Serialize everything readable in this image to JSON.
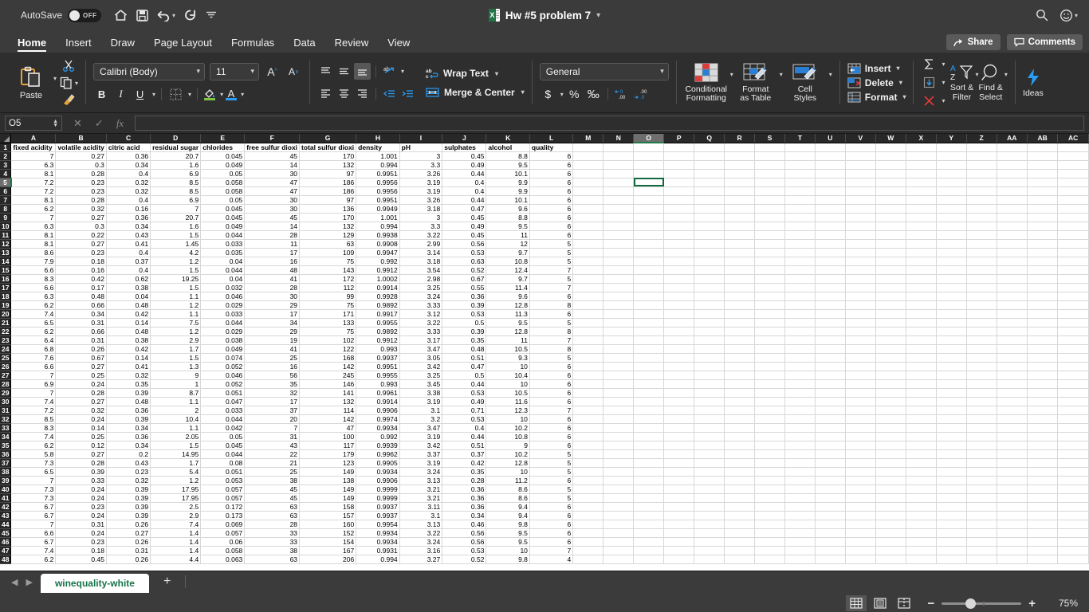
{
  "titlebar": {
    "autosave_label": "AutoSave",
    "autosave_state": "OFF",
    "document_title": "Hw #5 problem 7",
    "quick_access": [
      "home-icon",
      "save-icon",
      "undo-icon",
      "redo-icon",
      "customize-icon"
    ],
    "right_icons": [
      "search-icon",
      "account-icon"
    ]
  },
  "tabs": [
    {
      "label": "Home",
      "active": true
    },
    {
      "label": "Insert",
      "active": false
    },
    {
      "label": "Draw",
      "active": false
    },
    {
      "label": "Page Layout",
      "active": false
    },
    {
      "label": "Formulas",
      "active": false
    },
    {
      "label": "Data",
      "active": false
    },
    {
      "label": "Review",
      "active": false
    },
    {
      "label": "View",
      "active": false
    }
  ],
  "tabbar_right": {
    "share_label": "Share",
    "comments_label": "Comments"
  },
  "ribbon": {
    "clipboard": {
      "paste_label": "Paste",
      "cut_icon": "scissors-icon",
      "copy_icon": "copy-icon",
      "format_painter_icon": "format-painter-icon"
    },
    "font": {
      "font_name": "Calibri (Body)",
      "font_size": "11",
      "grow_font": "A",
      "shrink_font": "A",
      "bold": "B",
      "italic": "I",
      "underline": "U",
      "fill_color": "#7dc242",
      "font_color": "#2a9df4"
    },
    "alignment": {
      "wrap_text_label": "Wrap Text",
      "merge_center_label": "Merge & Center",
      "orientation_icon": "orientation-icon"
    },
    "number": {
      "format": "General",
      "currency": "$",
      "percent": "%",
      "comma": "‰",
      "increase_decimal": "increase-decimal-icon",
      "decrease_decimal": "decrease-decimal-icon"
    },
    "styles": [
      {
        "label": "Conditional\nFormatting",
        "line1": "Conditional",
        "line2": "Formatting"
      },
      {
        "label": "Format as Table",
        "line1": "Format",
        "line2": "as Table"
      },
      {
        "label": "Cell Styles",
        "line1": "Cell",
        "line2": "Styles"
      }
    ],
    "cells": {
      "insert_label": "Insert",
      "delete_label": "Delete",
      "format_label": "Format"
    },
    "editing": {
      "autosum_icon": "sigma-icon",
      "fill_icon": "fill-down-icon",
      "clear_icon": "clear-icon",
      "sort_filter_line1": "Sort &",
      "sort_filter_line2": "Filter",
      "find_select_line1": "Find &",
      "find_select_line2": "Select"
    },
    "ideas": {
      "label": "Ideas"
    }
  },
  "formula_bar": {
    "name_box": "O5",
    "formula_value": "",
    "cancel_icon": "x-icon",
    "confirm_icon": "check-icon",
    "function_icon": "fx-icon"
  },
  "sheet": {
    "selected_cell": "O5",
    "selected_col_index": 15,
    "selected_row_index": 5,
    "columns": [
      "A",
      "B",
      "C",
      "D",
      "E",
      "F",
      "G",
      "H",
      "I",
      "J",
      "K",
      "L",
      "M",
      "N",
      "O",
      "P",
      "Q",
      "R",
      "S",
      "T",
      "U",
      "V",
      "W",
      "X",
      "Y",
      "Z",
      "AA",
      "AB",
      "AC"
    ],
    "headers": [
      "fixed acidity",
      "volatile acidity",
      "citric acid",
      "residual sugar",
      "chlorides",
      "free sulfur dioxi",
      "total sulfur dioxi",
      "density",
      "pH",
      "sulphates",
      "alcohol",
      "quality"
    ],
    "rows": [
      [
        7,
        0.27,
        0.36,
        20.7,
        0.045,
        45,
        170,
        1.001,
        3,
        0.45,
        8.8,
        6
      ],
      [
        6.3,
        0.3,
        0.34,
        1.6,
        0.049,
        14,
        132,
        0.994,
        3.3,
        0.49,
        9.5,
        6
      ],
      [
        8.1,
        0.28,
        0.4,
        6.9,
        0.05,
        30,
        97,
        0.9951,
        3.26,
        0.44,
        10.1,
        6
      ],
      [
        7.2,
        0.23,
        0.32,
        8.5,
        0.058,
        47,
        186,
        0.9956,
        3.19,
        0.4,
        9.9,
        6
      ],
      [
        7.2,
        0.23,
        0.32,
        8.5,
        0.058,
        47,
        186,
        0.9956,
        3.19,
        0.4,
        9.9,
        6
      ],
      [
        8.1,
        0.28,
        0.4,
        6.9,
        0.05,
        30,
        97,
        0.9951,
        3.26,
        0.44,
        10.1,
        6
      ],
      [
        6.2,
        0.32,
        0.16,
        7,
        0.045,
        30,
        136,
        0.9949,
        3.18,
        0.47,
        9.6,
        6
      ],
      [
        7,
        0.27,
        0.36,
        20.7,
        0.045,
        45,
        170,
        1.001,
        3,
        0.45,
        8.8,
        6
      ],
      [
        6.3,
        0.3,
        0.34,
        1.6,
        0.049,
        14,
        132,
        0.994,
        3.3,
        0.49,
        9.5,
        6
      ],
      [
        8.1,
        0.22,
        0.43,
        1.5,
        0.044,
        28,
        129,
        0.9938,
        3.22,
        0.45,
        11,
        6
      ],
      [
        8.1,
        0.27,
        0.41,
        1.45,
        0.033,
        11,
        63,
        0.9908,
        2.99,
        0.56,
        12,
        5
      ],
      [
        8.6,
        0.23,
        0.4,
        4.2,
        0.035,
        17,
        109,
        0.9947,
        3.14,
        0.53,
        9.7,
        5
      ],
      [
        7.9,
        0.18,
        0.37,
        1.2,
        0.04,
        16,
        75,
        0.992,
        3.18,
        0.63,
        10.8,
        5
      ],
      [
        6.6,
        0.16,
        0.4,
        1.5,
        0.044,
        48,
        143,
        0.9912,
        3.54,
        0.52,
        12.4,
        7
      ],
      [
        8.3,
        0.42,
        0.62,
        19.25,
        0.04,
        41,
        172,
        1.0002,
        2.98,
        0.67,
        9.7,
        5
      ],
      [
        6.6,
        0.17,
        0.38,
        1.5,
        0.032,
        28,
        112,
        0.9914,
        3.25,
        0.55,
        11.4,
        7
      ],
      [
        6.3,
        0.48,
        0.04,
        1.1,
        0.046,
        30,
        99,
        0.9928,
        3.24,
        0.36,
        9.6,
        6
      ],
      [
        6.2,
        0.66,
        0.48,
        1.2,
        0.029,
        29,
        75,
        0.9892,
        3.33,
        0.39,
        12.8,
        8
      ],
      [
        7.4,
        0.34,
        0.42,
        1.1,
        0.033,
        17,
        171,
        0.9917,
        3.12,
        0.53,
        11.3,
        6
      ],
      [
        6.5,
        0.31,
        0.14,
        7.5,
        0.044,
        34,
        133,
        0.9955,
        3.22,
        0.5,
        9.5,
        5
      ],
      [
        6.2,
        0.66,
        0.48,
        1.2,
        0.029,
        29,
        75,
        0.9892,
        3.33,
        0.39,
        12.8,
        8
      ],
      [
        6.4,
        0.31,
        0.38,
        2.9,
        0.038,
        19,
        102,
        0.9912,
        3.17,
        0.35,
        11,
        7
      ],
      [
        6.8,
        0.26,
        0.42,
        1.7,
        0.049,
        41,
        122,
        0.993,
        3.47,
        0.48,
        10.5,
        8
      ],
      [
        7.6,
        0.67,
        0.14,
        1.5,
        0.074,
        25,
        168,
        0.9937,
        3.05,
        0.51,
        9.3,
        5
      ],
      [
        6.6,
        0.27,
        0.41,
        1.3,
        0.052,
        16,
        142,
        0.9951,
        3.42,
        0.47,
        10,
        6
      ],
      [
        7,
        0.25,
        0.32,
        9,
        0.046,
        56,
        245,
        0.9955,
        3.25,
        0.5,
        10.4,
        6
      ],
      [
        6.9,
        0.24,
        0.35,
        1,
        0.052,
        35,
        146,
        0.993,
        3.45,
        0.44,
        10,
        6
      ],
      [
        7,
        0.28,
        0.39,
        8.7,
        0.051,
        32,
        141,
        0.9961,
        3.38,
        0.53,
        10.5,
        6
      ],
      [
        7.4,
        0.27,
        0.48,
        1.1,
        0.047,
        17,
        132,
        0.9914,
        3.19,
        0.49,
        11.6,
        6
      ],
      [
        7.2,
        0.32,
        0.36,
        2,
        0.033,
        37,
        114,
        0.9906,
        3.1,
        0.71,
        12.3,
        7
      ],
      [
        8.5,
        0.24,
        0.39,
        10.4,
        0.044,
        20,
        142,
        0.9974,
        3.2,
        0.53,
        10,
        6
      ],
      [
        8.3,
        0.14,
        0.34,
        1.1,
        0.042,
        7,
        47,
        0.9934,
        3.47,
        0.4,
        10.2,
        6
      ],
      [
        7.4,
        0.25,
        0.36,
        2.05,
        0.05,
        31,
        100,
        0.992,
        3.19,
        0.44,
        10.8,
        6
      ],
      [
        6.2,
        0.12,
        0.34,
        1.5,
        0.045,
        43,
        117,
        0.9939,
        3.42,
        0.51,
        9,
        6
      ],
      [
        5.8,
        0.27,
        0.2,
        14.95,
        0.044,
        22,
        179,
        0.9962,
        3.37,
        0.37,
        10.2,
        5
      ],
      [
        7.3,
        0.28,
        0.43,
        1.7,
        0.08,
        21,
        123,
        0.9905,
        3.19,
        0.42,
        12.8,
        5
      ],
      [
        6.5,
        0.39,
        0.23,
        5.4,
        0.051,
        25,
        149,
        0.9934,
        3.24,
        0.35,
        10,
        5
      ],
      [
        7,
        0.33,
        0.32,
        1.2,
        0.053,
        38,
        138,
        0.9906,
        3.13,
        0.28,
        11.2,
        6
      ],
      [
        7.3,
        0.24,
        0.39,
        17.95,
        0.057,
        45,
        149,
        0.9999,
        3.21,
        0.36,
        8.6,
        5
      ],
      [
        7.3,
        0.24,
        0.39,
        17.95,
        0.057,
        45,
        149,
        0.9999,
        3.21,
        0.36,
        8.6,
        5
      ],
      [
        6.7,
        0.23,
        0.39,
        2.5,
        0.172,
        63,
        158,
        0.9937,
        3.11,
        0.36,
        9.4,
        6
      ],
      [
        6.7,
        0.24,
        0.39,
        2.9,
        0.173,
        63,
        157,
        0.9937,
        3.1,
        0.34,
        9.4,
        6
      ],
      [
        7,
        0.31,
        0.26,
        7.4,
        0.069,
        28,
        160,
        0.9954,
        3.13,
        0.46,
        9.8,
        6
      ],
      [
        6.6,
        0.24,
        0.27,
        1.4,
        0.057,
        33,
        152,
        0.9934,
        3.22,
        0.56,
        9.5,
        6
      ],
      [
        6.7,
        0.23,
        0.26,
        1.4,
        0.06,
        33,
        154,
        0.9934,
        3.24,
        0.56,
        9.5,
        6
      ],
      [
        7.4,
        0.18,
        0.31,
        1.4,
        0.058,
        38,
        167,
        0.9931,
        3.16,
        0.53,
        10,
        7
      ],
      [
        6.2,
        0.45,
        0.26,
        4.4,
        0.063,
        63,
        206,
        0.994,
        3.27,
        0.52,
        9.8,
        4
      ]
    ]
  },
  "sheet_tabs": {
    "active_tab": "winequality-white",
    "add_label": "+",
    "prev_icon": "prev-sheet-icon",
    "next_icon": "next-sheet-icon"
  },
  "statusbar": {
    "views": [
      "normal-view-icon",
      "page-layout-icon",
      "page-break-icon"
    ],
    "zoom_out": "−",
    "zoom_in": "+",
    "zoom_level": "75%"
  }
}
